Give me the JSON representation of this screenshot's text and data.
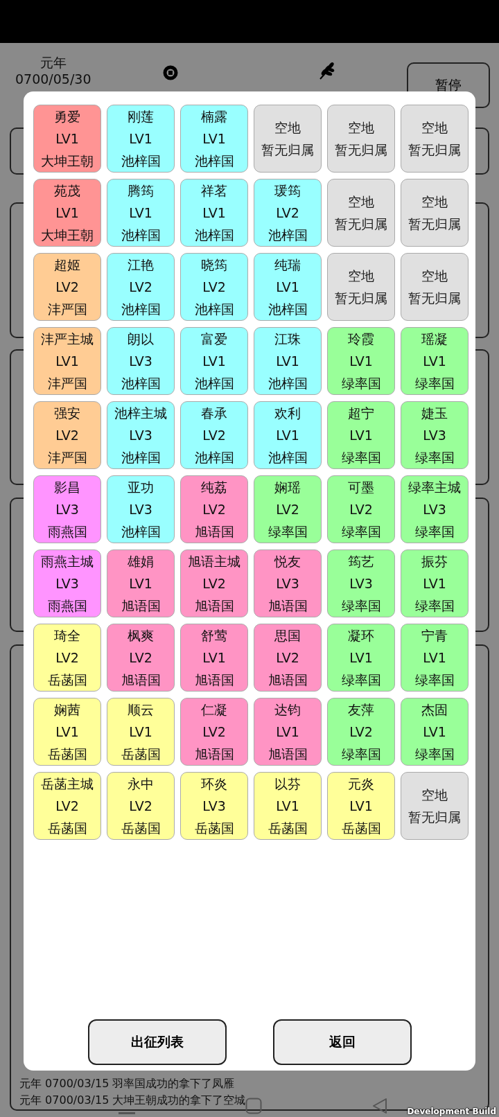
{
  "header": {
    "era": "元年",
    "date": "0700/05/30",
    "pause_button": "暂停"
  },
  "log": [
    "元年 0700/03/15  羽率国成功的拿下了凤雁",
    "元年 0700/03/15  大坤王朝成功的拿下了空城"
  ],
  "grid": [
    [
      {
        "kind": "city",
        "name": "勇爱",
        "level": "LV1",
        "owner": "大坤王朝",
        "color": "#ff9494"
      },
      {
        "kind": "city",
        "name": "刚莲",
        "level": "LV1",
        "owner": "池梓国",
        "color": "#99ffff"
      },
      {
        "kind": "city",
        "name": "楠露",
        "level": "LV1",
        "owner": "池梓国",
        "color": "#99ffff"
      },
      {
        "kind": "empty",
        "name": "空地",
        "owner": "暂无归属",
        "color": "#e0e0e0"
      },
      {
        "kind": "empty",
        "name": "空地",
        "owner": "暂无归属",
        "color": "#e0e0e0"
      },
      {
        "kind": "empty",
        "name": "空地",
        "owner": "暂无归属",
        "color": "#e0e0e0"
      }
    ],
    [
      {
        "kind": "city",
        "name": "苑茂",
        "level": "LV1",
        "owner": "大坤王朝",
        "color": "#ff9494"
      },
      {
        "kind": "city",
        "name": "腾筠",
        "level": "LV1",
        "owner": "池梓国",
        "color": "#99ffff"
      },
      {
        "kind": "city",
        "name": "祥茗",
        "level": "LV1",
        "owner": "池梓国",
        "color": "#99ffff"
      },
      {
        "kind": "city",
        "name": "瑗筠",
        "level": "LV2",
        "owner": "池梓国",
        "color": "#99ffff"
      },
      {
        "kind": "empty",
        "name": "空地",
        "owner": "暂无归属",
        "color": "#e0e0e0"
      },
      {
        "kind": "empty",
        "name": "空地",
        "owner": "暂无归属",
        "color": "#e0e0e0"
      }
    ],
    [
      {
        "kind": "city",
        "name": "超姬",
        "level": "LV2",
        "owner": "沣严国",
        "color": "#ffcc94"
      },
      {
        "kind": "city",
        "name": "江艳",
        "level": "LV2",
        "owner": "池梓国",
        "color": "#99ffff"
      },
      {
        "kind": "city",
        "name": "晓筠",
        "level": "LV2",
        "owner": "池梓国",
        "color": "#99ffff"
      },
      {
        "kind": "city",
        "name": "纯瑞",
        "level": "LV1",
        "owner": "池梓国",
        "color": "#99ffff"
      },
      {
        "kind": "empty",
        "name": "空地",
        "owner": "暂无归属",
        "color": "#e0e0e0"
      },
      {
        "kind": "empty",
        "name": "空地",
        "owner": "暂无归属",
        "color": "#e0e0e0"
      }
    ],
    [
      {
        "kind": "city",
        "name": "沣严主城",
        "level": "LV1",
        "owner": "沣严国",
        "color": "#ffcc94"
      },
      {
        "kind": "city",
        "name": "朗以",
        "level": "LV3",
        "owner": "池梓国",
        "color": "#99ffff"
      },
      {
        "kind": "city",
        "name": "富爱",
        "level": "LV1",
        "owner": "池梓国",
        "color": "#99ffff"
      },
      {
        "kind": "city",
        "name": "江珠",
        "level": "LV1",
        "owner": "池梓国",
        "color": "#99ffff"
      },
      {
        "kind": "city",
        "name": "玲霞",
        "level": "LV1",
        "owner": "绿率国",
        "color": "#99ff99"
      },
      {
        "kind": "city",
        "name": "瑶凝",
        "level": "LV1",
        "owner": "绿率国",
        "color": "#99ff99"
      }
    ],
    [
      {
        "kind": "city",
        "name": "强安",
        "level": "LV2",
        "owner": "沣严国",
        "color": "#ffcc94"
      },
      {
        "kind": "city",
        "name": "池梓主城",
        "level": "LV3",
        "owner": "池梓国",
        "color": "#99ffff"
      },
      {
        "kind": "city",
        "name": "春承",
        "level": "LV2",
        "owner": "池梓国",
        "color": "#99ffff"
      },
      {
        "kind": "city",
        "name": "欢利",
        "level": "LV1",
        "owner": "池梓国",
        "color": "#99ffff"
      },
      {
        "kind": "city",
        "name": "超宁",
        "level": "LV1",
        "owner": "绿率国",
        "color": "#99ff99"
      },
      {
        "kind": "city",
        "name": "婕玉",
        "level": "LV3",
        "owner": "绿率国",
        "color": "#99ff99"
      }
    ],
    [
      {
        "kind": "city",
        "name": "影昌",
        "level": "LV3",
        "owner": "雨燕国",
        "color": "#ff94ff"
      },
      {
        "kind": "city",
        "name": "亚功",
        "level": "LV3",
        "owner": "池梓国",
        "color": "#99ffff"
      },
      {
        "kind": "city",
        "name": "纯荔",
        "level": "LV2",
        "owner": "旭语国",
        "color": "#ff94c4"
      },
      {
        "kind": "city",
        "name": "娴瑶",
        "level": "LV2",
        "owner": "绿率国",
        "color": "#99ff99"
      },
      {
        "kind": "city",
        "name": "可墨",
        "level": "LV2",
        "owner": "绿率国",
        "color": "#99ff99"
      },
      {
        "kind": "city",
        "name": "绿率主城",
        "level": "LV3",
        "owner": "绿率国",
        "color": "#99ff99"
      }
    ],
    [
      {
        "kind": "city",
        "name": "雨燕主城",
        "level": "LV3",
        "owner": "雨燕国",
        "color": "#ff94ff"
      },
      {
        "kind": "city",
        "name": "雄娟",
        "level": "LV1",
        "owner": "旭语国",
        "color": "#ff94c4"
      },
      {
        "kind": "city",
        "name": "旭语主城",
        "level": "LV2",
        "owner": "旭语国",
        "color": "#ff94c4"
      },
      {
        "kind": "city",
        "name": "悦友",
        "level": "LV3",
        "owner": "旭语国",
        "color": "#ff94c4"
      },
      {
        "kind": "city",
        "name": "筠艺",
        "level": "LV3",
        "owner": "绿率国",
        "color": "#99ff99"
      },
      {
        "kind": "city",
        "name": "振芬",
        "level": "LV1",
        "owner": "绿率国",
        "color": "#99ff99"
      }
    ],
    [
      {
        "kind": "city",
        "name": "琦全",
        "level": "LV2",
        "owner": "岳菡国",
        "color": "#ffff99"
      },
      {
        "kind": "city",
        "name": "枫爽",
        "level": "LV2",
        "owner": "旭语国",
        "color": "#ff94c4"
      },
      {
        "kind": "city",
        "name": "舒莺",
        "level": "LV1",
        "owner": "旭语国",
        "color": "#ff94c4"
      },
      {
        "kind": "city",
        "name": "思国",
        "level": "LV2",
        "owner": "旭语国",
        "color": "#ff94c4"
      },
      {
        "kind": "city",
        "name": "凝环",
        "level": "LV1",
        "owner": "绿率国",
        "color": "#99ff99"
      },
      {
        "kind": "city",
        "name": "宁青",
        "level": "LV1",
        "owner": "绿率国",
        "color": "#99ff99"
      }
    ],
    [
      {
        "kind": "city",
        "name": "娴茜",
        "level": "LV1",
        "owner": "岳菡国",
        "color": "#ffff99"
      },
      {
        "kind": "city",
        "name": "顺云",
        "level": "LV1",
        "owner": "岳菡国",
        "color": "#ffff99"
      },
      {
        "kind": "city",
        "name": "仁凝",
        "level": "LV2",
        "owner": "旭语国",
        "color": "#ff94c4"
      },
      {
        "kind": "city",
        "name": "达钧",
        "level": "LV1",
        "owner": "旭语国",
        "color": "#ff94c4"
      },
      {
        "kind": "city",
        "name": "友萍",
        "level": "LV2",
        "owner": "绿率国",
        "color": "#99ff99"
      },
      {
        "kind": "city",
        "name": "杰固",
        "level": "LV1",
        "owner": "绿率国",
        "color": "#99ff99"
      }
    ],
    [
      {
        "kind": "city",
        "name": "岳菡主城",
        "level": "LV2",
        "owner": "岳菡国",
        "color": "#ffff99"
      },
      {
        "kind": "city",
        "name": "永中",
        "level": "LV2",
        "owner": "岳菡国",
        "color": "#ffff99"
      },
      {
        "kind": "city",
        "name": "环炎",
        "level": "LV3",
        "owner": "岳菡国",
        "color": "#ffff99"
      },
      {
        "kind": "city",
        "name": "以芬",
        "level": "LV1",
        "owner": "岳菡国",
        "color": "#ffff99"
      },
      {
        "kind": "city",
        "name": "元炎",
        "level": "LV1",
        "owner": "岳菡国",
        "color": "#ffff99"
      },
      {
        "kind": "empty",
        "name": "空地",
        "owner": "暂无归属",
        "color": "#e0e0e0"
      }
    ]
  ],
  "buttons": [
    "出征列表",
    "返回"
  ],
  "build_label": "Development Build"
}
